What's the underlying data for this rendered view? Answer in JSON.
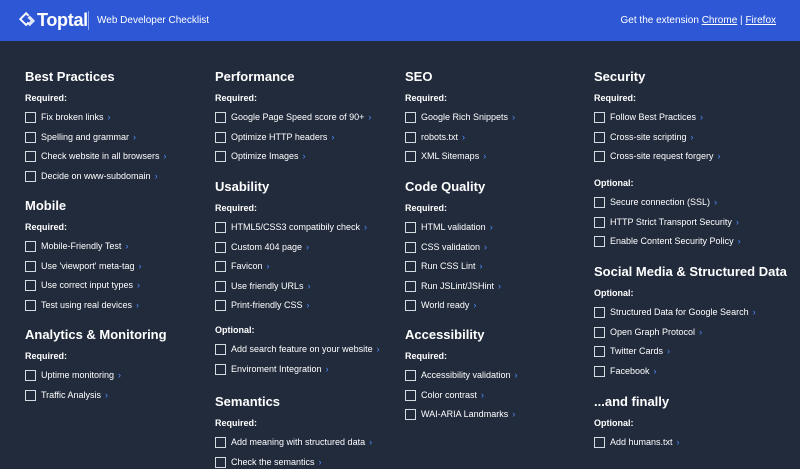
{
  "brand": {
    "name": "Toptal",
    "icon": "toptal-diamond-icon"
  },
  "app_title": "Web Developer Checklist",
  "extension": {
    "label": "Get the extension",
    "chrome": "Chrome",
    "separator": "|",
    "firefox": "Firefox"
  },
  "colors": {
    "header": "#2e57d5",
    "background": "#222b3c",
    "link_arrow": "#4d8dff"
  },
  "chevron": "›",
  "sections": {
    "best_practices": {
      "title": "Best Practices",
      "required": {
        "label": "Required:",
        "items": [
          "Fix broken links",
          "Spelling and grammar",
          "Check website in all browsers",
          "Decide on www-subdomain"
        ]
      }
    },
    "mobile": {
      "title": "Mobile",
      "required": {
        "label": "Required:",
        "items": [
          "Mobile-Friendly Test",
          "Use 'viewport' meta-tag",
          "Use correct input types",
          "Test using real devices"
        ]
      }
    },
    "analytics": {
      "title": "Analytics & Monitoring",
      "required": {
        "label": "Required:",
        "items": [
          "Uptime monitoring",
          "Traffic Analysis"
        ]
      }
    },
    "performance": {
      "title": "Performance",
      "required": {
        "label": "Required:",
        "items": [
          "Google Page Speed score of 90+",
          "Optimize HTTP headers",
          "Optimize Images"
        ]
      }
    },
    "usability": {
      "title": "Usability",
      "required": {
        "label": "Required:",
        "items": [
          "HTML5/CSS3 compatibily check",
          "Custom 404 page",
          "Favicon",
          "Use friendly URLs",
          "Print-friendly CSS"
        ]
      },
      "optional": {
        "label": "Optional:",
        "items": [
          "Add search feature on your website",
          "Enviroment Integration"
        ]
      }
    },
    "semantics": {
      "title": "Semantics",
      "required": {
        "label": "Required:",
        "items": [
          "Add meaning with structured data",
          "Check the semantics"
        ]
      }
    },
    "seo": {
      "title": "SEO",
      "required": {
        "label": "Required:",
        "items": [
          "Google Rich Snippets",
          "robots.txt",
          "XML Sitemaps"
        ]
      }
    },
    "code_quality": {
      "title": "Code Quality",
      "required": {
        "label": "Required:",
        "items": [
          "HTML validation",
          "CSS validation",
          "Run CSS Lint",
          "Run JSLint/JSHint",
          "World ready"
        ]
      }
    },
    "accessibility": {
      "title": "Accessibility",
      "required": {
        "label": "Required:",
        "items": [
          "Accessibility validation",
          "Color contrast",
          "WAI-ARIA Landmarks"
        ]
      }
    },
    "security": {
      "title": "Security",
      "required": {
        "label": "Required:",
        "items": [
          "Follow Best Practices",
          "Cross-site scripting",
          "Cross-site request forgery"
        ]
      },
      "optional": {
        "label": "Optional:",
        "items": [
          "Secure connection (SSL)",
          "HTTP Strict Transport Security",
          "Enable Content Security Policy"
        ]
      }
    },
    "social": {
      "title": "Social Media & Structured Data",
      "optional": {
        "label": "Optional:",
        "items": [
          "Structured Data for Google Search",
          "Open Graph Protocol",
          "Twitter Cards",
          "Facebook"
        ]
      }
    },
    "finally": {
      "title": "...and finally",
      "optional": {
        "label": "Optional:",
        "items": [
          "Add humans.txt"
        ]
      }
    }
  }
}
